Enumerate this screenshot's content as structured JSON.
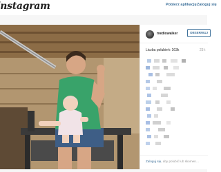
{
  "header": {
    "logo_text": "Instagram",
    "get_app": "Pobierz aplikację",
    "login": "Zaloguj się"
  },
  "post": {
    "username": "mediowalker",
    "follow_label": "OBSERWUJ",
    "likes": "Liczba polubień: 163k",
    "date": "23 t",
    "login_prompt_link": "Zaloguj się",
    "login_prompt_rest": ", aby polubić lub skomen…"
  },
  "colors": {
    "accent": "#3f729b"
  }
}
